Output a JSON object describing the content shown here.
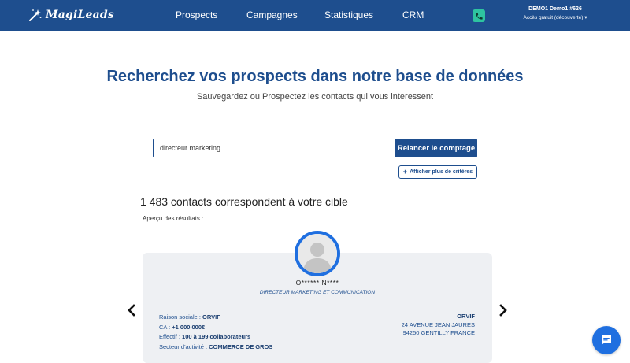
{
  "app": {
    "logo_text": "MagiLeads",
    "nav": [
      "Prospects",
      "Campagnes",
      "Statistiques",
      "CRM"
    ],
    "user_name": "DEMO1 Demo1 #626",
    "user_plan": "Accès gratuit (découverte)",
    "colors": {
      "primary": "#1e4e8e",
      "phone": "#2ec4a0",
      "accent": "#1f6fe0"
    }
  },
  "hero": {
    "title": "Recherchez vos prospects dans notre base de données",
    "subtitle": "Sauvegardez ou Prospectez les contacts qui vous interessent"
  },
  "search": {
    "value": "directeur marketing",
    "button_label": "Relancer le comptage",
    "more_label": "Afficher plus de critères"
  },
  "results": {
    "count_title": "1 483 contacts correspondent à votre cible",
    "preview_label": "Aperçu des résultats :"
  },
  "contact": {
    "name": "O****** N****",
    "role": "DIRECTEUR MARKETING ET COMMUNICATION",
    "raison_label": "Raison sociale : ",
    "raison_value": "ORVIF",
    "ca_label": "CA : ",
    "ca_value": "+1 000 000€",
    "effectif_label": "Effectif : ",
    "effectif_value": "100 à 199 collaborateurs",
    "secteur_label": "Secteur d'activité : ",
    "secteur_value": "COMMERCE DE GROS",
    "company": "ORVIF",
    "address1": "24 AVENUE JEAN JAURES",
    "address2": "94250 GENTILLY FRANCE"
  },
  "icons": [
    "magic-wand-icon",
    "phone-icon",
    "caret-down-icon",
    "plus-icon",
    "avatar-placeholder-icon",
    "chevron-left-icon",
    "chevron-right-icon",
    "chat-icon"
  ]
}
